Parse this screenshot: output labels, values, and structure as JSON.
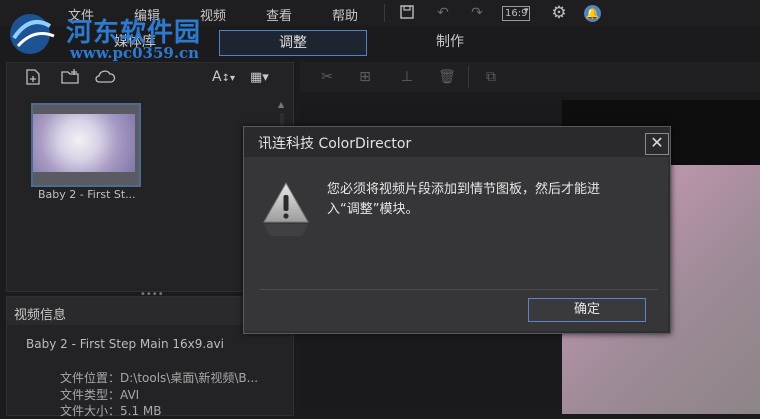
{
  "menu": {
    "items": [
      "文件",
      "编辑",
      "视频",
      "查看",
      "帮助"
    ],
    "aspect_ratio": "16:9"
  },
  "watermark": {
    "title": "河东软件园",
    "url": "www.pc0359.cn"
  },
  "modes": {
    "library": "媒体库",
    "adjust": "调整",
    "produce": "制作"
  },
  "library": {
    "thumbnail_label": "Baby 2 - First St...",
    "text_button": "A"
  },
  "info": {
    "title": "视频信息",
    "file_name": "Baby 2 - First Step Main 16x9.avi",
    "location": "文件位置：D:\\tools\\桌面\\新视频\\B...",
    "type": "文件类型：AVI",
    "size": "文件大小：5.1 MB"
  },
  "dialog": {
    "title": "讯连科技 ColorDirector",
    "message": "您必须将视频片段添加到情节图板，然后才能进入“调整”模块。",
    "ok": "确定"
  },
  "colors": {
    "accent": "#4d84c8",
    "watermark": "#2e7ad1"
  }
}
